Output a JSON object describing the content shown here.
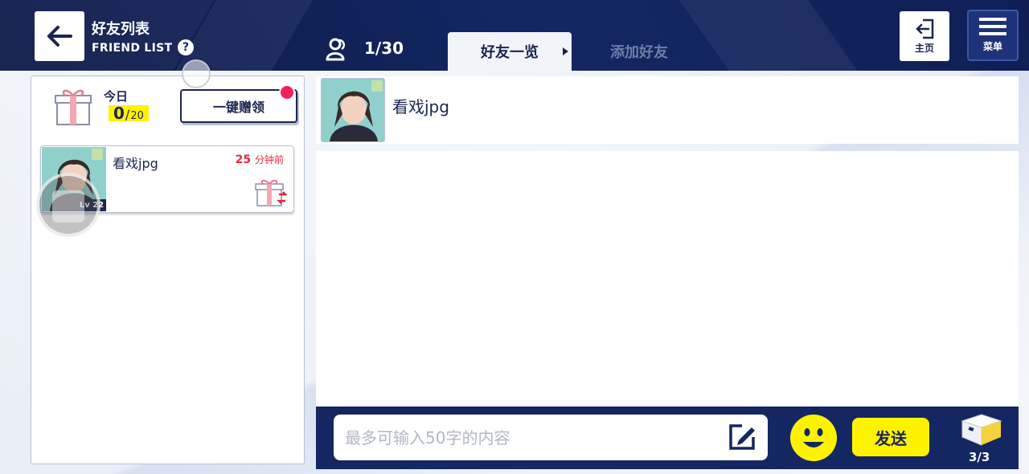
{
  "header": {
    "title_zh": "好友列表",
    "title_en": "FRIEND LIST",
    "help_symbol": "?",
    "friend_count": "1/30",
    "tabs": [
      {
        "label": "好友一览",
        "active": true
      },
      {
        "label": "添加好友",
        "active": false
      }
    ],
    "home_label": "主页",
    "menu_label": "菜单"
  },
  "gift_panel": {
    "today_label": "今日",
    "received": "0",
    "separator": "/",
    "limit": "20",
    "claim_all_label": "一键赠领"
  },
  "friends": [
    {
      "name": "看戏jpg",
      "level": "Lv 22",
      "time_value": "25",
      "time_unit": "分钟前"
    }
  ],
  "chat": {
    "friend_name": "看戏jpg",
    "input_placeholder": "最多可输入50字的内容",
    "send_label": "发送",
    "box_count": "3/3"
  },
  "colors": {
    "navy": "#142762",
    "accent_yellow": "#fff200",
    "alert_red": "#e8273f"
  },
  "icons": [
    "back-arrow-icon",
    "help-icon",
    "friends-icon",
    "home-exit-icon",
    "menu-icon",
    "gift-icon",
    "gift-send-icon",
    "edit-icon",
    "smiley-icon",
    "gift-box-icon"
  ]
}
